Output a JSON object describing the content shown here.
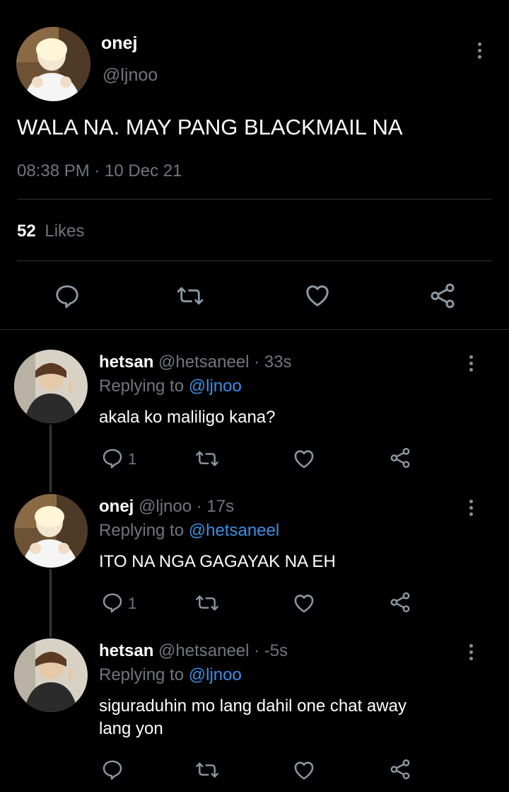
{
  "main_tweet": {
    "display_name": "onej",
    "handle": "@ljnoo",
    "text": "WALA NA. MAY PANG BLACKMAIL NA",
    "timestamp": "08:38 PM · 10 Dec 21",
    "likes_count": "52",
    "likes_label": "Likes"
  },
  "replies": [
    {
      "display_name": "hetsan",
      "handle_time": "@hetsaneel · 33s",
      "replying_prefix": "Replying to",
      "replying_to": "@ljnoo",
      "text_lines": [
        "akala ko maliligo kana?"
      ],
      "reply_count": "1"
    },
    {
      "display_name": "onej",
      "handle_time": "@ljnoo · 17s",
      "replying_prefix": "Replying to",
      "replying_to": "@hetsaneel",
      "text_lines": [
        "ITO NA NGA GAGAYAK NA EH"
      ],
      "reply_count": "1"
    },
    {
      "display_name": "hetsan",
      "handle_time": "@hetsaneel · -5s",
      "replying_prefix": "Replying to",
      "replying_to": "@ljnoo",
      "text_lines": [
        "siguraduhin mo lang dahil one chat away",
        "lang yon"
      ],
      "reply_count": ""
    }
  ],
  "icons": {
    "reply": "reply-icon",
    "retweet": "retweet-icon",
    "like": "like-icon",
    "share": "share-icon",
    "more": "more-icon"
  },
  "colors": {
    "background": "#000000",
    "muted_text": "#71767b",
    "link": "#3a8ee6",
    "divider": "#2f3336"
  }
}
